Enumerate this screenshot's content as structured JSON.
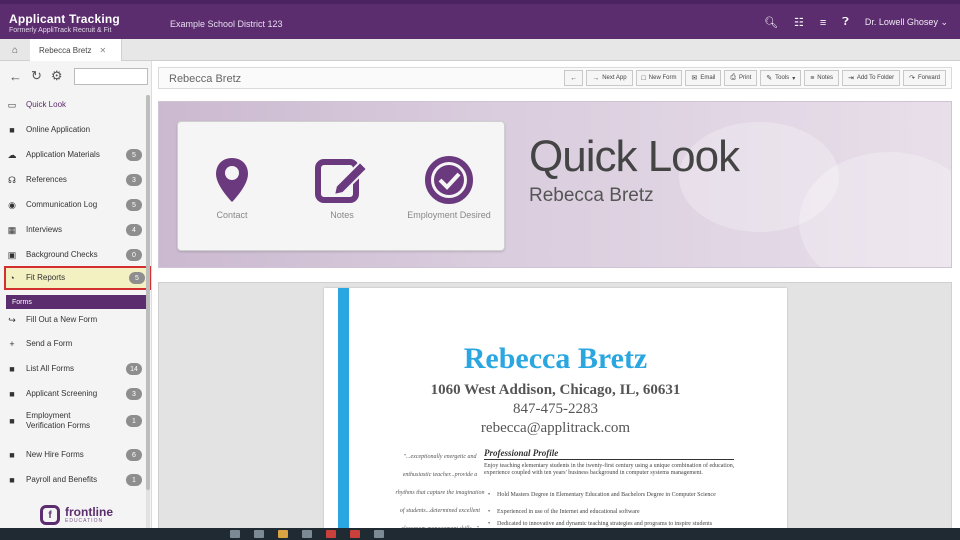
{
  "app": {
    "title": "Applicant Tracking",
    "subtitle": "Formerly AppliTrack Recruit & Fit",
    "district": "Example School District 123",
    "user": "Dr. Lowell Ghosey"
  },
  "tabs": {
    "active": "Rebecca Bretz"
  },
  "sidebar": {
    "section_forms": "Forms",
    "items": [
      {
        "label": "Quick Look",
        "icon": "monitor-icon",
        "badge": null
      },
      {
        "label": "Online Application",
        "icon": "document-icon",
        "badge": null
      },
      {
        "label": "Application Materials",
        "icon": "cloud-upload-icon",
        "badge": "5"
      },
      {
        "label": "References",
        "icon": "headset-icon",
        "badge": "3"
      },
      {
        "label": "Communication Log",
        "icon": "chat-icon",
        "badge": "5"
      },
      {
        "label": "Interviews",
        "icon": "calendar-icon",
        "badge": "4"
      },
      {
        "label": "Background Checks",
        "icon": "id-card-icon",
        "badge": "0"
      },
      {
        "label": "Fit Reports",
        "icon": "chart-icon",
        "badge": "5"
      },
      {
        "label": "Fill Out a New Form",
        "icon": "share-icon",
        "badge": null
      },
      {
        "label": "Send a Form",
        "icon": "plus-icon",
        "badge": null
      },
      {
        "label": "List All Forms",
        "icon": "document-icon",
        "badge": "14"
      },
      {
        "label": "Applicant Screening",
        "icon": "document-icon",
        "badge": "3"
      },
      {
        "label": "Employment Verification Forms",
        "icon": "document-icon",
        "badge": "1"
      },
      {
        "label": "New Hire Forms",
        "icon": "document-icon",
        "badge": "6"
      },
      {
        "label": "Payroll and Benefits",
        "icon": "document-icon",
        "badge": "1"
      }
    ],
    "logo_name": "frontline",
    "logo_sub": "EDUCATION"
  },
  "main": {
    "applicant_name": "Rebecca Bretz",
    "actions": [
      {
        "label": "",
        "icon": "arrow-left-icon"
      },
      {
        "label": "Next App",
        "icon": "next-icon"
      },
      {
        "label": "New Form",
        "icon": "new-form-icon"
      },
      {
        "label": "Email",
        "icon": "email-icon"
      },
      {
        "label": "Print",
        "icon": "print-icon"
      },
      {
        "label": "Tools",
        "icon": "tools-icon"
      },
      {
        "label": "Notes",
        "icon": "notes-icon"
      },
      {
        "label": "Add To Folder",
        "icon": "folder-icon"
      },
      {
        "label": "Forward",
        "icon": "forward-icon"
      }
    ]
  },
  "hero": {
    "title": "Quick Look",
    "name": "Rebecca Bretz",
    "cards": [
      {
        "label": "Contact",
        "icon": "map-pin-icon"
      },
      {
        "label": "Notes",
        "icon": "edit-icon"
      },
      {
        "label": "Employment Desired",
        "icon": "check-circle-icon"
      }
    ],
    "accent": "#6b3a7e"
  },
  "resume": {
    "name": "Rebecca Bretz",
    "address": "1060 West Addison, Chicago, IL, 60631",
    "phone": "847-475-2283",
    "email": "rebecca@applitrack.com",
    "quote_lines": [
      "\"...exceptionally energetic and",
      "enthusiastic teacher...provide a",
      "rhythms that capture the imagination",
      "of students...determined excellent",
      "classroom management skills...\""
    ],
    "profile_heading": "Professional Profile",
    "profile_text": "Enjoy teaching elementary students in the twenty-first century using a unique combination of education, experience coupled with ten years' business background in computer systems management.",
    "bullets": [
      "Hold Masters Degree in Elementary Education and Bachelors Degree in Computer Science",
      "Experienced in use of the Internet and educational software",
      "Dedicated to innovative and dynamic teaching strategies and programs to inspire students"
    ],
    "accent": "#2aa6e0"
  }
}
